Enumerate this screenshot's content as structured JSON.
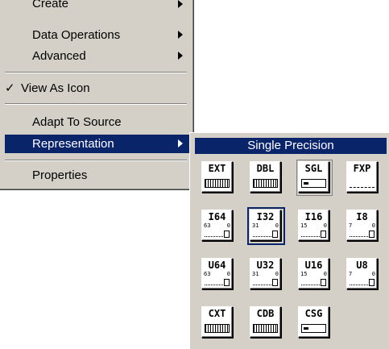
{
  "context_menu": {
    "items": [
      {
        "label": "Create",
        "has_submenu": true
      },
      {
        "label": "Data Operations",
        "has_submenu": true
      },
      {
        "label": "Advanced",
        "has_submenu": true
      },
      {
        "label": "View As Icon",
        "checked": true,
        "check_glyph": "✓"
      },
      {
        "label": "Adapt To Source"
      },
      {
        "label": "Representation",
        "has_submenu": true,
        "highlighted": true
      },
      {
        "label": "Properties"
      }
    ]
  },
  "representation_palette": {
    "title": "Single Precision",
    "selected": "I32",
    "hovered": "SGL",
    "tiles": [
      {
        "code": "EXT",
        "kind": "float"
      },
      {
        "code": "DBL",
        "kind": "float"
      },
      {
        "code": "SGL",
        "kind": "float"
      },
      {
        "code": "FXP",
        "kind": "fixed"
      },
      {
        "code": "I64",
        "bits_hi": "63",
        "bits_lo": "0"
      },
      {
        "code": "I32",
        "bits_hi": "31",
        "bits_lo": "0"
      },
      {
        "code": "I16",
        "bits_hi": "15",
        "bits_lo": "0"
      },
      {
        "code": "I8",
        "bits_hi": "7",
        "bits_lo": "0"
      },
      {
        "code": "U64",
        "bits_hi": "63",
        "bits_lo": "0"
      },
      {
        "code": "U32",
        "bits_hi": "31",
        "bits_lo": "0"
      },
      {
        "code": "U16",
        "bits_hi": "15",
        "bits_lo": "0"
      },
      {
        "code": "U8",
        "bits_hi": "7",
        "bits_lo": "0"
      },
      {
        "code": "CXT",
        "kind": "complex"
      },
      {
        "code": "CDB",
        "kind": "complex"
      },
      {
        "code": "CSG",
        "kind": "complex"
      }
    ]
  },
  "colors": {
    "highlight": "#0a246a",
    "menu_bg": "#d4d0c8"
  }
}
